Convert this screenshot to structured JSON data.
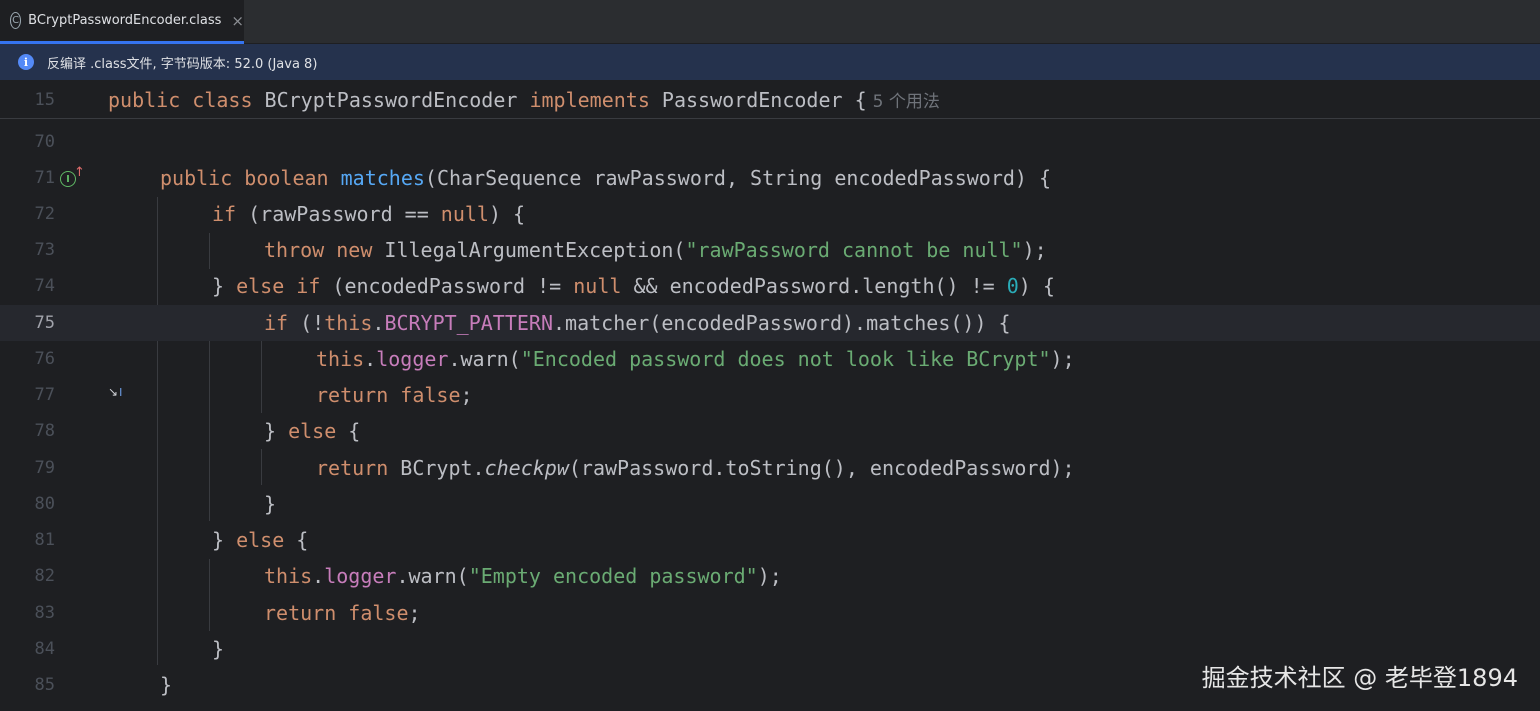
{
  "tab": {
    "label": "BCryptPasswordEncoder.class",
    "icon": "class-icon",
    "close": "×"
  },
  "banner": {
    "text": "反编译 .class文件, 字节码版本: 52.0 (Java 8)",
    "icon": "info-icon"
  },
  "sticky": {
    "line_number": "15",
    "usages_hint": "5 个用法"
  },
  "lines": [
    {
      "n": "70"
    },
    {
      "n": "71"
    },
    {
      "n": "72"
    },
    {
      "n": "73"
    },
    {
      "n": "74"
    },
    {
      "n": "75"
    },
    {
      "n": "76"
    },
    {
      "n": "77"
    },
    {
      "n": "78"
    },
    {
      "n": "79"
    },
    {
      "n": "80"
    },
    {
      "n": "81"
    },
    {
      "n": "82"
    },
    {
      "n": "83"
    },
    {
      "n": "84"
    },
    {
      "n": "85"
    }
  ],
  "watermark": "掘金技术社区 @ 老毕登1894"
}
